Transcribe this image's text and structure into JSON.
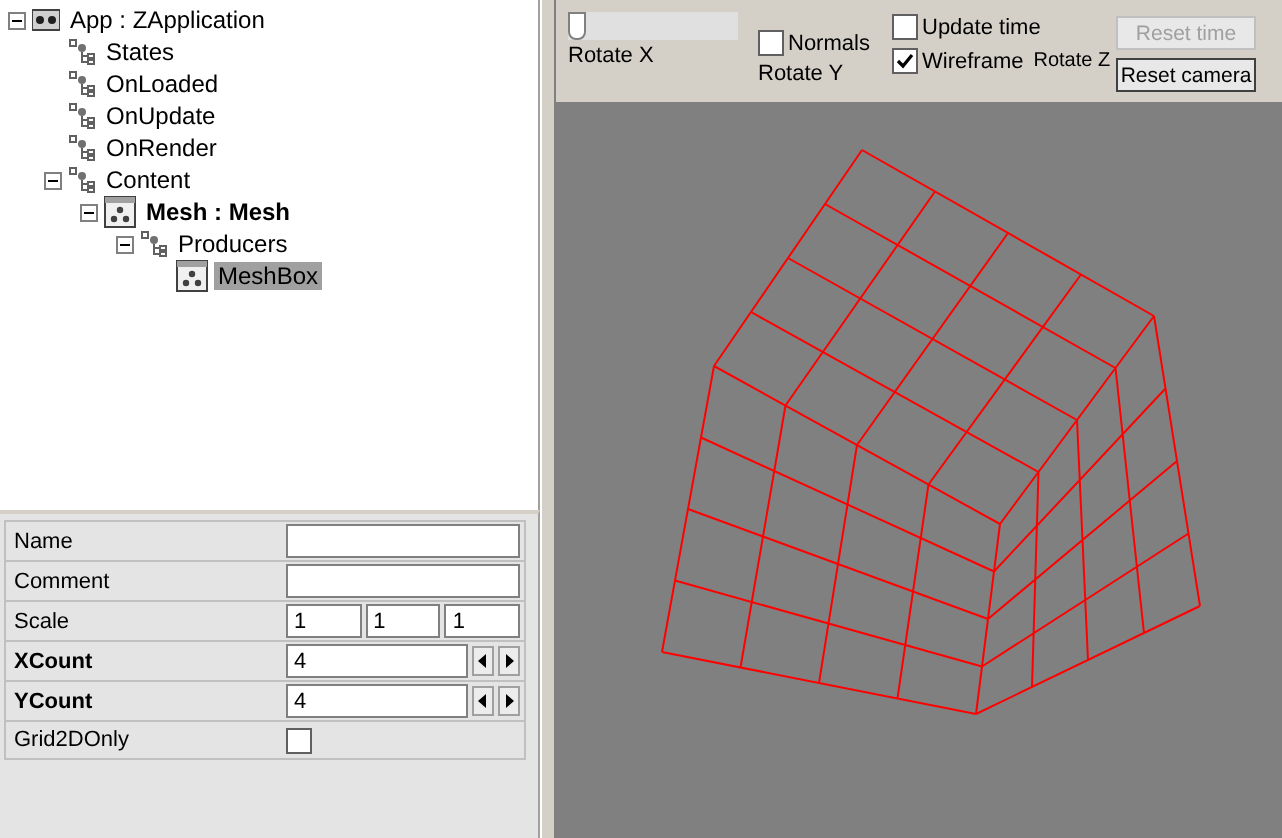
{
  "tree": [
    {
      "label": "App : ZApplication",
      "kind": "app",
      "bold": false,
      "selected": false,
      "expanded": true,
      "children": [
        {
          "label": "States",
          "kind": "list",
          "bold": false,
          "selected": false
        },
        {
          "label": "OnLoaded",
          "kind": "list",
          "bold": false,
          "selected": false
        },
        {
          "label": "OnUpdate",
          "kind": "list",
          "bold": false,
          "selected": false
        },
        {
          "label": "OnRender",
          "kind": "list",
          "bold": false,
          "selected": false
        },
        {
          "label": "Content",
          "kind": "list",
          "bold": false,
          "selected": false,
          "expanded": true,
          "children": [
            {
              "label": "Mesh : Mesh",
              "kind": "component",
              "bold": true,
              "selected": false,
              "expanded": true,
              "children": [
                {
                  "label": "Producers",
                  "kind": "list",
                  "bold": false,
                  "selected": false,
                  "expanded": true,
                  "children": [
                    {
                      "label": "MeshBox",
                      "kind": "component",
                      "bold": false,
                      "selected": true
                    }
                  ]
                }
              ]
            }
          ]
        }
      ]
    }
  ],
  "properties": [
    {
      "label": "Name",
      "kind": "text",
      "bold": false
    },
    {
      "label": "Comment",
      "kind": "text",
      "bold": false
    },
    {
      "label": "Scale",
      "kind": "vector",
      "bold": false,
      "values": [
        "1",
        "1",
        "1"
      ]
    },
    {
      "label": "XCount",
      "kind": "number",
      "bold": true,
      "values": [
        "4"
      ]
    },
    {
      "label": "YCount",
      "kind": "number",
      "bold": true,
      "values": [
        "4"
      ]
    },
    {
      "label": "Grid2DOnly",
      "kind": "checkbox",
      "bold": false,
      "checked": false
    }
  ],
  "toolbar": {
    "rotate_x": {
      "label": "Rotate X",
      "level": 0.0
    },
    "rotate_y": {
      "label": "Rotate Y"
    },
    "rotate_z": {
      "label": "Rotate Z"
    },
    "checkboxes": [
      {
        "label": "Normals",
        "checked": false
      },
      {
        "label": "Update time",
        "checked": false
      },
      {
        "label": "Wireframe",
        "checked": true
      }
    ],
    "buttons": [
      {
        "label": "Reset time",
        "disabled": true
      },
      {
        "label": "Reset camera",
        "disabled": false
      }
    ]
  }
}
